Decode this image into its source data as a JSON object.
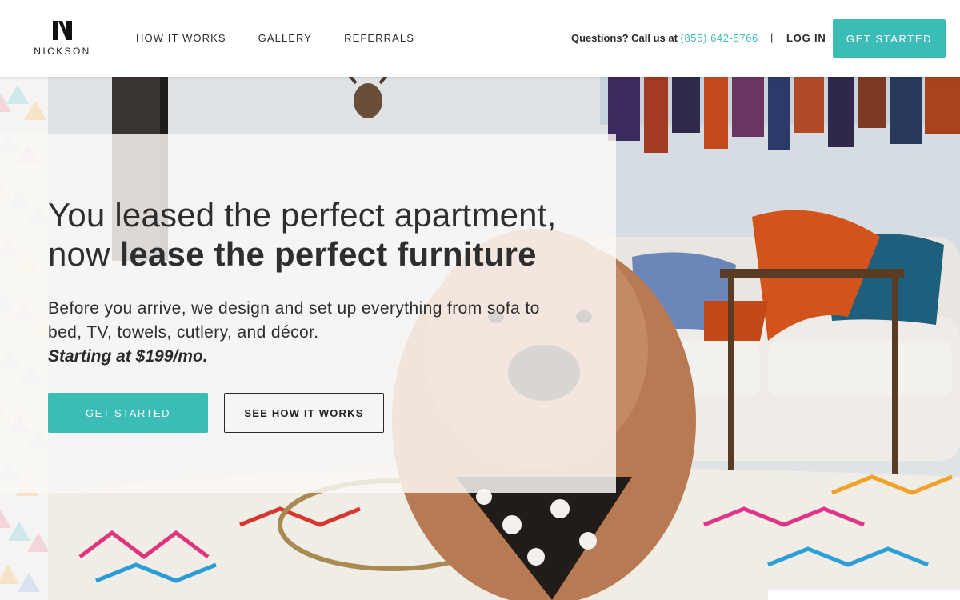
{
  "brand": {
    "name": "NICKSON",
    "accent": "#3cbcb6"
  },
  "nav": {
    "items": [
      {
        "label": "HOW IT WORKS"
      },
      {
        "label": "GALLERY"
      },
      {
        "label": "REFERRALS"
      }
    ]
  },
  "header": {
    "phone_prefix": "Questions? Call us at",
    "phone_number": "(855) 642-5766",
    "divider": "|",
    "login_label": "LOG IN",
    "cta_label": "GET STARTED"
  },
  "hero": {
    "headline_regular": "You leased the perfect apartment, now ",
    "headline_bold": "lease the perfect furniture",
    "subtext": "Before you arrive, we design and set up everything from sofa to bed, TV, towels, cutlery, and décor.",
    "price": "Starting at $199/mo.",
    "primary_cta": "GET STARTED",
    "secondary_cta": "SEE HOW IT WORKS"
  },
  "icons": {
    "logo": "nickson-logo-mark",
    "photo": "living-room-dog-photo",
    "pattern": "triangle-pattern"
  }
}
